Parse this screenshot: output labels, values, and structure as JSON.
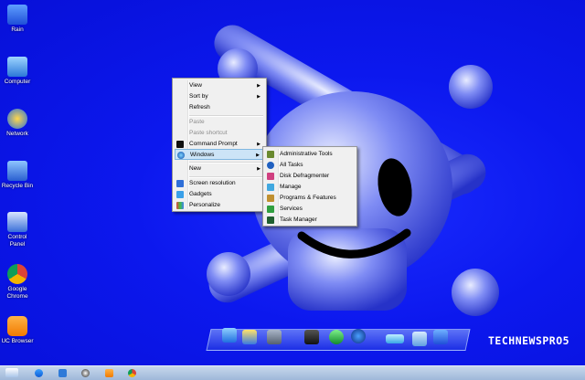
{
  "desktop_icons": [
    {
      "label": "Rain",
      "icon": "rain-folder-icon"
    },
    {
      "label": "Computer",
      "icon": "computer-icon"
    },
    {
      "label": "Network",
      "icon": "network-icon"
    },
    {
      "label": "Recycle Bin",
      "icon": "recycle-bin-icon"
    },
    {
      "label": "Control Panel",
      "icon": "control-panel-icon"
    },
    {
      "label": "Google Chrome",
      "icon": "chrome-icon"
    },
    {
      "label": "UC Browser",
      "icon": "uc-browser-icon"
    }
  ],
  "context_menu": {
    "items": [
      {
        "label": "View",
        "submenu": true
      },
      {
        "label": "Sort by",
        "submenu": true
      },
      {
        "label": "Refresh"
      },
      {
        "label": "Paste",
        "disabled": true
      },
      {
        "label": "Paste shortcut",
        "disabled": true
      },
      {
        "label": "Command Prompt",
        "submenu": true,
        "icon": "cmd-icon"
      },
      {
        "label": "Windows",
        "submenu": true,
        "icon": "windows-icon",
        "highlighted": true
      },
      {
        "label": "New",
        "submenu": true
      },
      {
        "label": "Screen resolution",
        "icon": "screen-resolution-icon"
      },
      {
        "label": "Gadgets",
        "icon": "gadgets-icon"
      },
      {
        "label": "Personalize",
        "icon": "personalize-icon"
      }
    ]
  },
  "windows_submenu": {
    "items": [
      {
        "label": "Administrative Tools",
        "icon": "admin-tools-icon"
      },
      {
        "label": "All Tasks",
        "icon": "all-tasks-icon"
      },
      {
        "label": "Disk Defragmenter",
        "icon": "disk-defrag-icon"
      },
      {
        "label": "Manage",
        "icon": "manage-icon"
      },
      {
        "label": "Programs & Features",
        "icon": "programs-features-icon"
      },
      {
        "label": "Services",
        "icon": "services-icon"
      },
      {
        "label": "Task Manager",
        "icon": "task-manager-icon"
      }
    ]
  },
  "watermark": "TECHNEWSPRO5",
  "colors": {
    "desktop": "#0c18ee",
    "menu_bg": "#f0f0f0",
    "highlight": "#cce4f7"
  }
}
